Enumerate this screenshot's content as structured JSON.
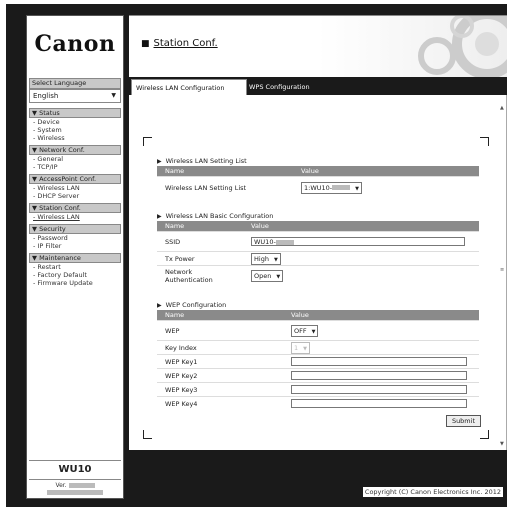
{
  "sidebar": {
    "logo": "Canon",
    "language_label": "Select Language",
    "language_value": "English",
    "groups": [
      {
        "title": "▼ Status",
        "items": [
          "- Device",
          "- System",
          "- Wireless"
        ]
      },
      {
        "title": "▼ Network Conf.",
        "items": [
          "- General",
          "- TCP/IP"
        ]
      },
      {
        "title": "▼ AccessPoint Conf.",
        "items": [
          "- Wireless LAN",
          "- DHCP Server"
        ]
      },
      {
        "title": "▼ Station Conf.",
        "items": [
          "- Wireless LAN"
        ]
      },
      {
        "title": "▼ Security",
        "items": [
          "- Password",
          "- IP Filter"
        ]
      },
      {
        "title": "▼ Maintenance",
        "items": [
          "- Restart",
          "- Factory Default",
          "- Firmware Update"
        ]
      }
    ],
    "model": "WU10",
    "version_label": "Ver."
  },
  "header": {
    "title": "Station Conf."
  },
  "tabs": {
    "active": "Wireless LAN Configuration",
    "inactive": "WPS Configuration"
  },
  "sections": {
    "setting_list": {
      "title": "Wireless LAN Setting List",
      "col_name": "Name",
      "col_value": "Value",
      "row_label": "Wireless LAN Setting List",
      "row_value": "1:WU10-"
    },
    "basic": {
      "title": "Wireless LAN Basic Configuration",
      "col_name": "Name",
      "col_value": "Value",
      "ssid_label": "SSID",
      "ssid_value": "WU10-",
      "txpower_label": "Tx Power",
      "txpower_value": "High",
      "auth_label": "Network Authentication",
      "auth_value": "Open"
    },
    "wep": {
      "title": "WEP Configuration",
      "col_name": "Name",
      "col_value": "Value",
      "wep_label": "WEP",
      "wep_value": "OFF",
      "keyindex_label": "Key Index",
      "keyindex_value": "1",
      "key1_label": "WEP Key1",
      "key2_label": "WEP Key2",
      "key3_label": "WEP Key3",
      "key4_label": "WEP Key4"
    },
    "submit_label": "Submit"
  },
  "footer": {
    "copyright": "Copyright (C) Canon Electronics Inc. 2012"
  }
}
